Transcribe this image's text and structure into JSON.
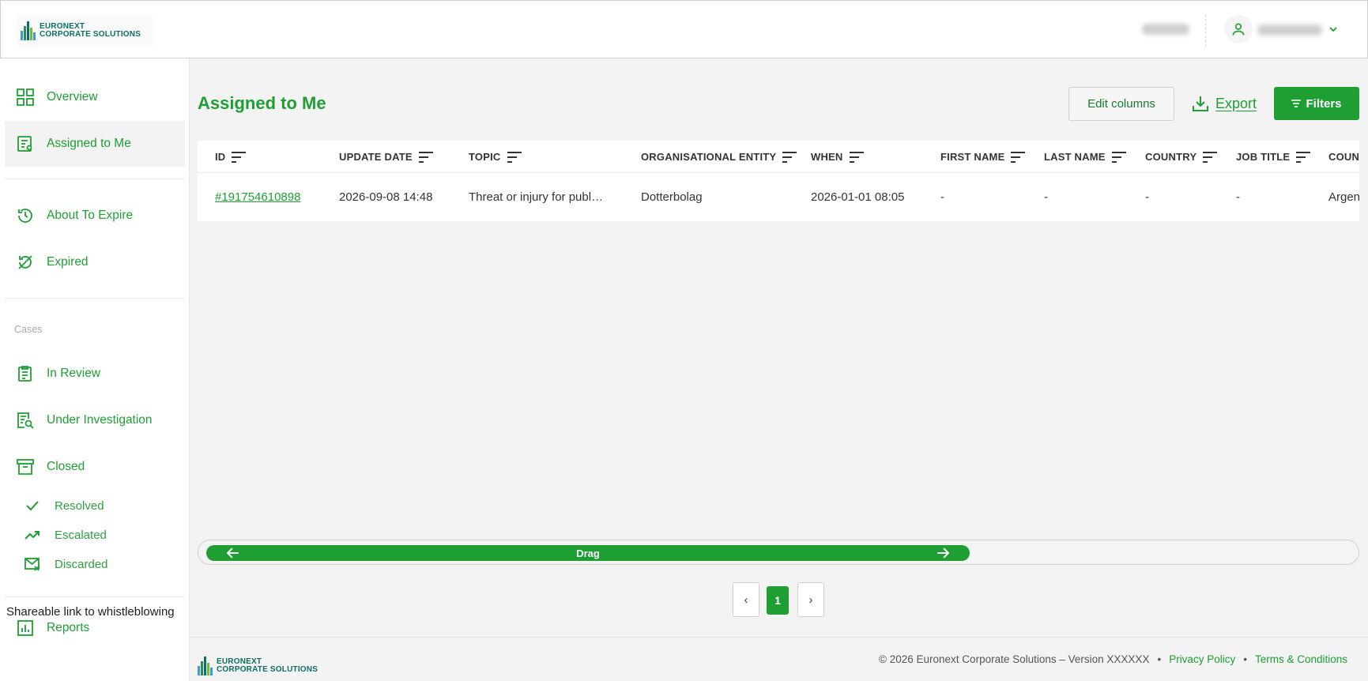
{
  "brand": {
    "line1": "EURONEXT",
    "line2": "CORPORATE SOLUTIONS"
  },
  "sidebar": {
    "items": [
      {
        "label": "Overview",
        "icon": "grid-icon"
      },
      {
        "label": "Assigned to Me",
        "icon": "assigned-list-icon"
      },
      {
        "label": "About To Expire",
        "icon": "history-icon"
      },
      {
        "label": "Expired",
        "icon": "expired-icon"
      },
      {
        "label": "In Review",
        "icon": "clipboard-icon"
      },
      {
        "label": "Under Investigation",
        "icon": "document-search-icon"
      },
      {
        "label": "Closed",
        "icon": "archive-box-icon"
      },
      {
        "label": "Reports",
        "icon": "bar-chart-icon"
      }
    ],
    "cases_section": "Cases",
    "closed_sub": [
      {
        "label": "Resolved",
        "icon": "check-icon"
      },
      {
        "label": "Escalated",
        "icon": "trending-up-icon"
      },
      {
        "label": "Discarded",
        "icon": "mail-x-icon"
      }
    ],
    "share_link": "Shareable link to whistleblowing"
  },
  "main": {
    "title": "Assigned to Me",
    "edit_columns": "Edit columns",
    "export": "Export",
    "filters": "Filters"
  },
  "table": {
    "columns": [
      "ID",
      "UPDATE DATE",
      "TOPIC",
      "ORGANISATIONAL ENTITY",
      "WHEN",
      "FIRST NAME",
      "LAST NAME",
      "COUNTRY",
      "JOB TITLE",
      "COUNT"
    ],
    "rows": [
      [
        "#191754610898",
        "2026-09-08 14:48",
        "Threat or injury for publ…",
        "Dotterbolag",
        "2026-01-01 08:05",
        "-",
        "-",
        "-",
        "-",
        "Argen"
      ]
    ]
  },
  "scrollbar": {
    "label": "Drag"
  },
  "pagination": {
    "prev": "‹",
    "current": "1",
    "next": "›"
  },
  "footer": {
    "copyright": "© 2026 Euronext Corporate Solutions – Version XXXXXX",
    "sep": "•",
    "privacy": "Privacy Policy",
    "terms": "Terms & Conditions"
  },
  "colors": {
    "accent": "#1e9e33",
    "brand_teal": "#0d6e63"
  }
}
